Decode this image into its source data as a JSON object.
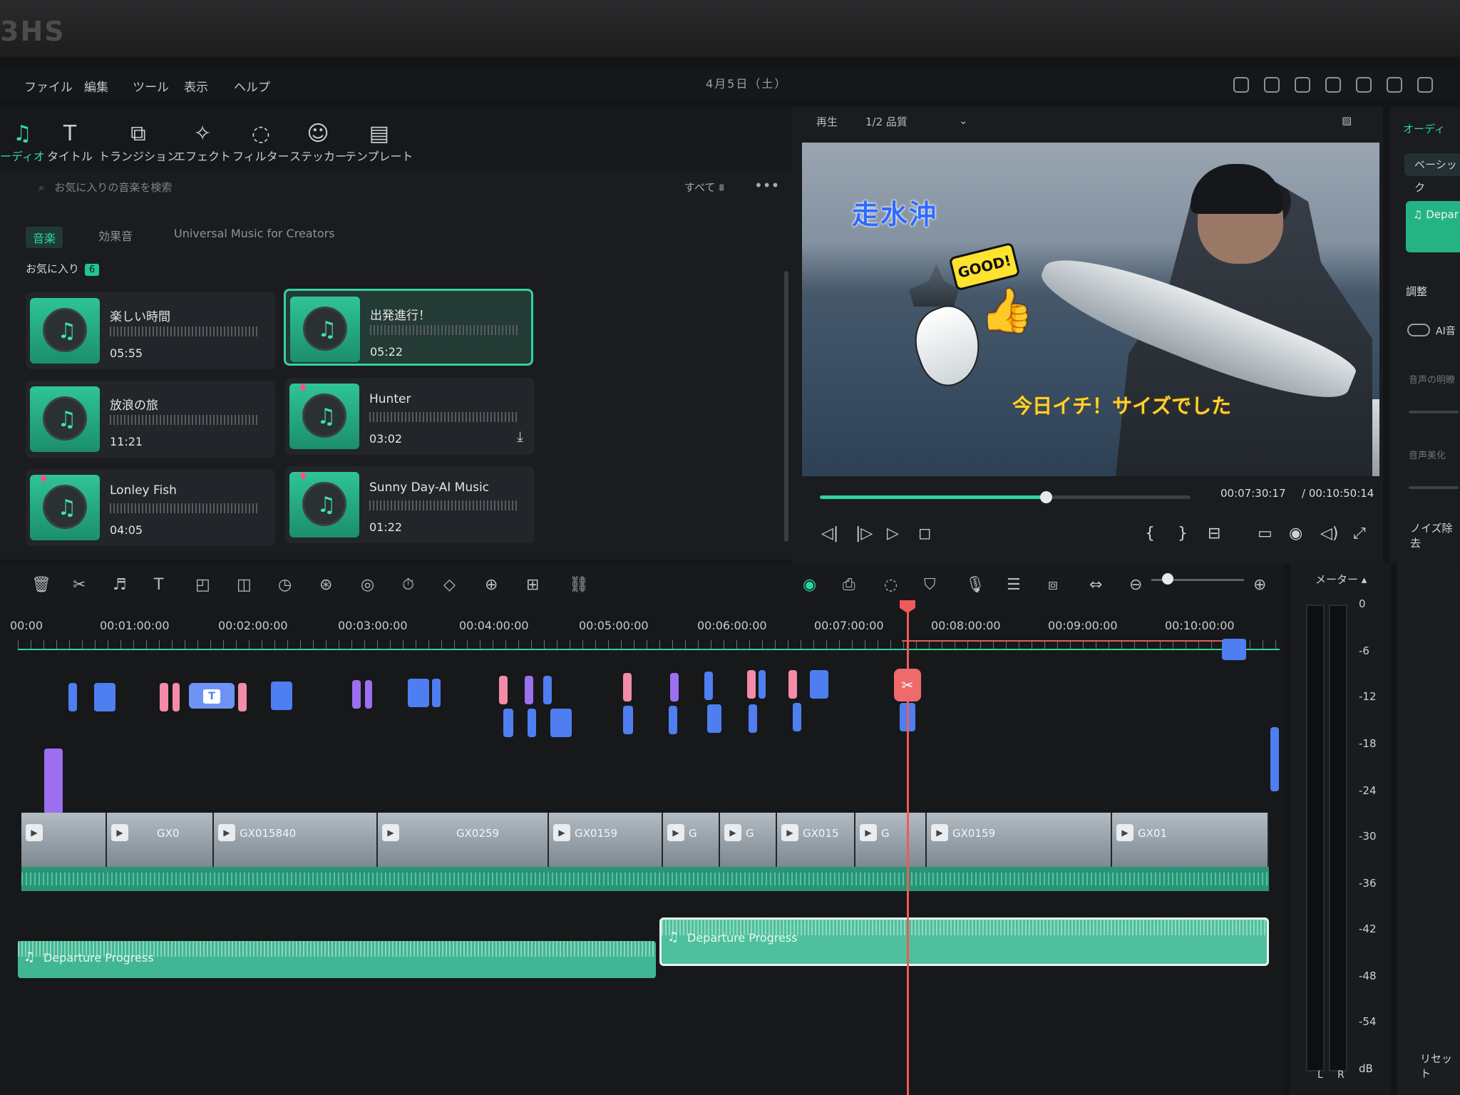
{
  "brand": "3HS",
  "menu": [
    "ファイル",
    "編集",
    "ツール",
    "表示",
    "ヘルプ"
  ],
  "date": "4月5日（土）",
  "tools": [
    {
      "label": "ーディオ",
      "icon": "♫"
    },
    {
      "label": "タイトル",
      "icon": "T"
    },
    {
      "label": "トランジション",
      "icon": "⧉"
    },
    {
      "label": "エフェクト",
      "icon": "✧"
    },
    {
      "label": "フィルター",
      "icon": "◌"
    },
    {
      "label": "ステッカー",
      "icon": "☺"
    },
    {
      "label": "テンプレート",
      "icon": "▤"
    }
  ],
  "library": {
    "search_placeholder": "お気に入りの音楽を検索",
    "filter_label": "すべて",
    "more": "•••",
    "tabs": [
      "音楽",
      "効果音",
      "Universal Music for Creators"
    ],
    "favorites_label": "お気に入り",
    "favorites_count": "6",
    "tracks": [
      {
        "title": "楽しい時間",
        "duration": "05:55"
      },
      {
        "title": "出発進行！",
        "duration": "05:22"
      },
      {
        "title": "放浪の旅",
        "duration": "11:21"
      },
      {
        "title": "Hunter",
        "duration": "03:02"
      },
      {
        "title": "Lonley Fish",
        "duration": "04:05"
      },
      {
        "title": "Sunny Day-AI Music",
        "duration": "01:22"
      }
    ]
  },
  "preview": {
    "playback_label": "再生",
    "quality": "1/2 品質",
    "caption_top": "走水沖",
    "caption_bottom": "今日イチ！サイズでした",
    "sticker_text": "GOOD!",
    "current_time": "00:07:30:17",
    "total_time": "/ 00:10:50:14",
    "progress": 0.61
  },
  "right_panel": {
    "tab": "オーディ",
    "basic": "ベーシック",
    "clip": "Depar",
    "adjust": "調整",
    "ai_label": "AI音",
    "label1": "音声の明瞭",
    "label2": "音声美化",
    "noise": "ノイズ除去"
  },
  "ruler": [
    "00:00",
    "00:01:00:00",
    "00:02:00:00",
    "00:03:00:00",
    "00:04:00:00",
    "00:05:00:00",
    "00:06:00:00",
    "00:07:00:00",
    "00:08:00:00",
    "00:09:00:00",
    "00:10:00:00"
  ],
  "video_clips": [
    "GX0",
    "GX015840",
    "GX0259",
    "GX0159",
    "G",
    "G",
    "GX015",
    "G",
    "GX0159",
    "GX01"
  ],
  "audio_clips": [
    "Departure Progress",
    "Departure Progress"
  ],
  "meter": {
    "title": "メーター",
    "labels": [
      "0",
      "-6",
      "-12",
      "-18",
      "-24",
      "-30",
      "-36",
      "-42",
      "-48",
      "-54",
      "dB"
    ],
    "l": "L",
    "r": "R",
    "reset": "リセット"
  }
}
